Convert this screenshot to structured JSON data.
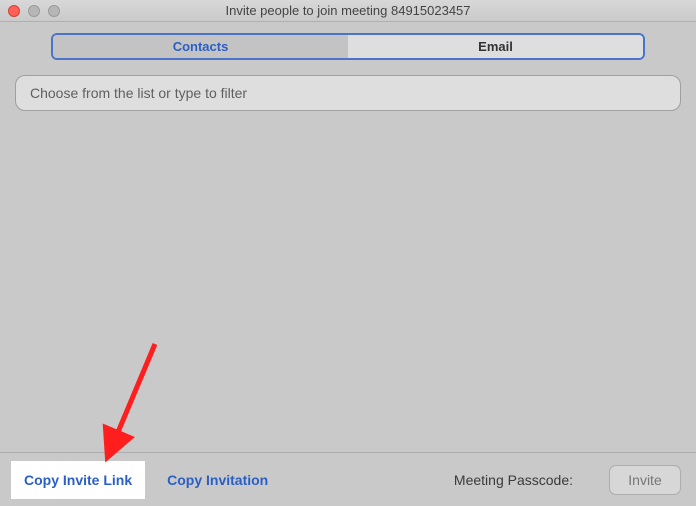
{
  "window": {
    "title": "Invite people to join meeting 84915023457"
  },
  "tabs": {
    "contacts": "Contacts",
    "email": "Email"
  },
  "filter": {
    "placeholder": "Choose from the list or type to filter"
  },
  "footer": {
    "copy_link": "Copy Invite Link",
    "copy_invitation": "Copy Invitation",
    "passcode_label": "Meeting Passcode:",
    "invite": "Invite"
  },
  "meta": {
    "active_tab": "contacts"
  }
}
